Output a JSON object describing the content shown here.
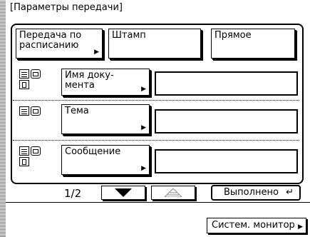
{
  "title": "[Параметры передачи]",
  "top_buttons": {
    "schedule": "Передача по расписанию",
    "schedule_line1": "Передача по",
    "schedule_line2": "расписанию",
    "stamp": "Штамп",
    "direct": "Прямое"
  },
  "fields": {
    "document_name_line1": "Имя доку-",
    "document_name_line2": "мента",
    "document_name_value": "",
    "subject": "Тема",
    "subject_value": "",
    "message": "Сообщение",
    "message_value": ""
  },
  "icons": {
    "row_icons": [
      "doc-icon",
      "mail-icon",
      "clip-icon"
    ]
  },
  "pagination": {
    "page": "1/2",
    "down_icon": "triangle-down-icon",
    "up_icon": "triangle-up-icon"
  },
  "done": "Выполнено",
  "system_monitor": "Систем. монитор"
}
